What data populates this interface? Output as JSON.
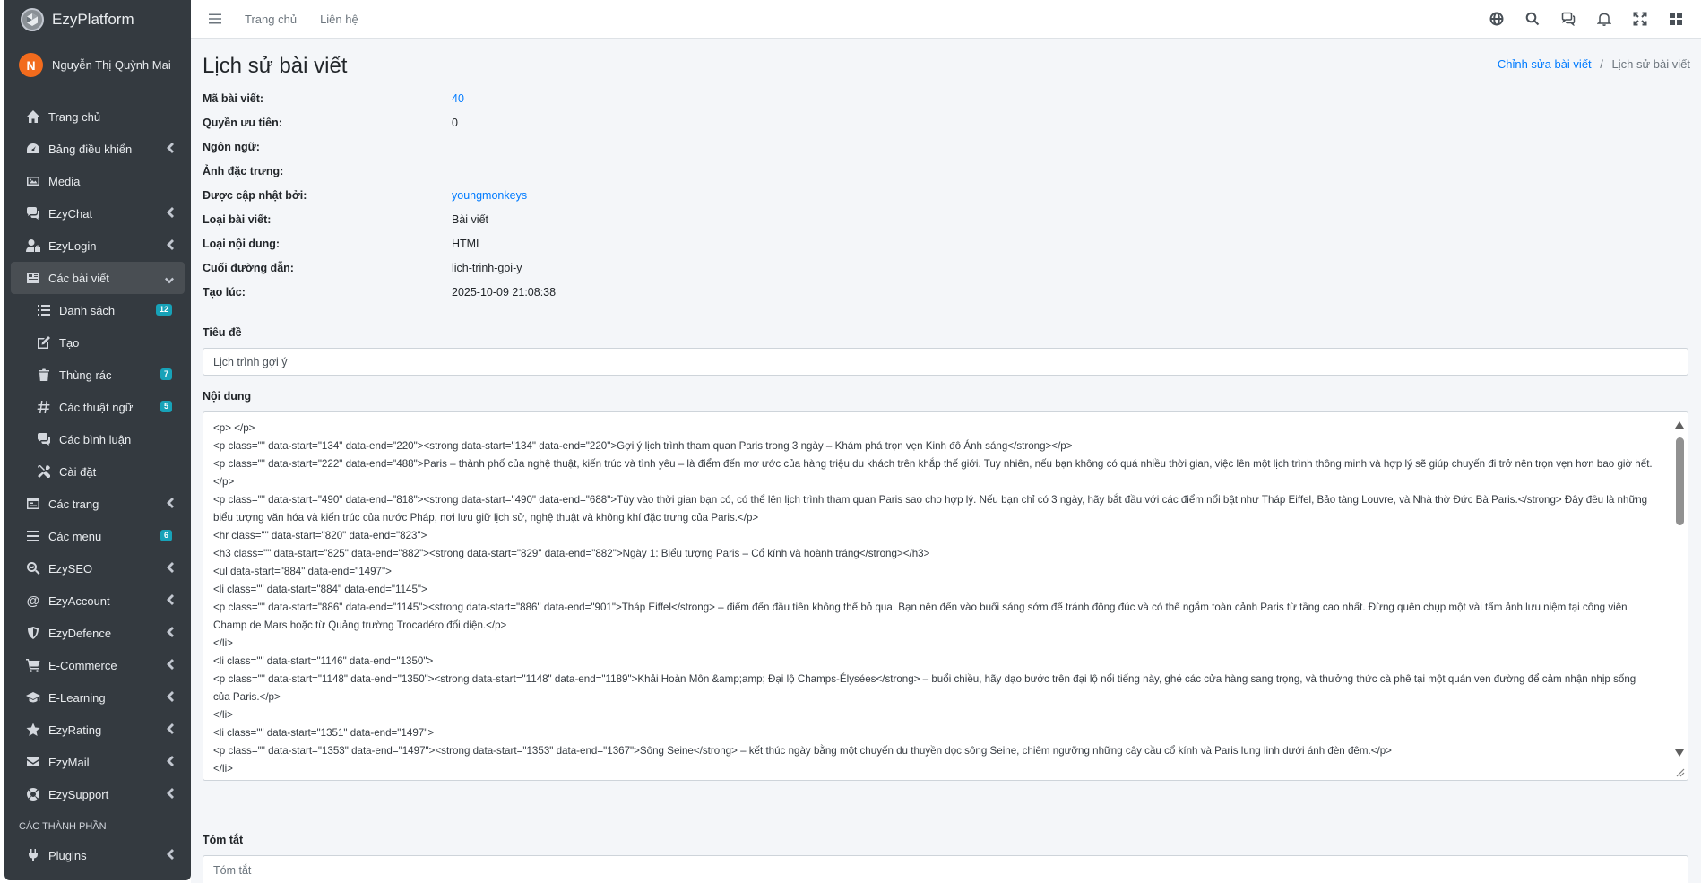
{
  "brand": {
    "name": "EzyPlatform"
  },
  "user": {
    "initial": "N",
    "name": "Nguyễn Thị Quỳnh Mai"
  },
  "sidebar": {
    "items": [
      {
        "label": "Trang chủ",
        "icon": "home-icon"
      },
      {
        "label": "Bảng điều khiển",
        "icon": "dashboard-icon"
      },
      {
        "label": "Media",
        "icon": "image-icon"
      },
      {
        "label": "EzyChat",
        "icon": "chat-icon"
      },
      {
        "label": "EzyLogin",
        "icon": "user-lock-icon"
      },
      {
        "label": "Các bài viết",
        "icon": "newspaper-icon"
      },
      {
        "label": "Danh sách",
        "icon": "list-icon",
        "badge": "12"
      },
      {
        "label": "Tạo",
        "icon": "edit-icon"
      },
      {
        "label": "Thùng rác",
        "icon": "trash-icon",
        "badge": "7"
      },
      {
        "label": "Các thuật ngữ",
        "icon": "hashtag-icon",
        "badge": "5"
      },
      {
        "label": "Các bình luận",
        "icon": "comments-icon"
      },
      {
        "label": "Cài đặt",
        "icon": "tools-icon"
      },
      {
        "label": "Các trang",
        "icon": "pages-icon"
      },
      {
        "label": "Các menu",
        "icon": "menu-icon",
        "badge": "6"
      },
      {
        "label": "EzySEO",
        "icon": "seo-icon"
      },
      {
        "label": "EzyAccount",
        "icon": "at-icon"
      },
      {
        "label": "EzyDefence",
        "icon": "shield-icon"
      },
      {
        "label": "E-Commerce",
        "icon": "cart-icon"
      },
      {
        "label": "E-Learning",
        "icon": "graduation-icon"
      },
      {
        "label": "EzyRating",
        "icon": "star-icon"
      },
      {
        "label": "EzyMail",
        "icon": "mail-icon"
      },
      {
        "label": "EzySupport",
        "icon": "support-icon"
      }
    ],
    "section_header": "CÁC THÀNH PHẦN",
    "plugins": {
      "label": "Plugins",
      "icon": "plug-icon"
    }
  },
  "topbar": {
    "home": "Trang chủ",
    "contact": "Liên hệ"
  },
  "page": {
    "title": "Lịch sử bài viết",
    "breadcrumb": {
      "parent": "Chỉnh sửa bài viết",
      "sep": "/",
      "current": "Lịch sử bài viết"
    }
  },
  "info": {
    "post_id_label": "Mã bài viết:",
    "post_id": "40",
    "priority_label": "Quyền ưu tiên:",
    "priority": "0",
    "language_label": "Ngôn ngữ:",
    "language": "",
    "featured_label": "Ảnh đặc trưng:",
    "featured": "",
    "updated_by_label": "Được cập nhật bởi:",
    "updated_by": "youngmonkeys",
    "post_type_label": "Loại bài viết:",
    "post_type": "Bài viết",
    "content_type_label": "Loại nội dung:",
    "content_type": "HTML",
    "slug_label": "Cuối đường dẫn:",
    "slug": "lich-trinh-goi-y",
    "created_label": "Tạo lúc:",
    "created": "2025-10-09 21:08:38"
  },
  "title_field": {
    "label": "Tiêu đề",
    "value": "Lịch trình gợi ý"
  },
  "content_field": {
    "label": "Nội dung",
    "lines": [
      "<p> </p>",
      "<p class=\"\" data-start=\"134\" data-end=\"220\"><strong data-start=\"134\" data-end=\"220\">Gợi ý lịch trình tham quan Paris trong 3 ngày – Khám phá trọn vẹn Kinh đô Ánh sáng</strong></p>",
      "<p class=\"\" data-start=\"222\" data-end=\"488\">Paris – thành phố của nghệ thuật, kiến trúc và tình yêu – là điểm đến mơ ước của hàng triệu du khách trên khắp thế giới. Tuy nhiên, nếu bạn không có quá nhiều thời gian, việc lên một lịch trình thông minh và hợp lý sẽ giúp chuyến đi trở nên trọn vẹn hơn bao giờ hết.</p>",
      "<p class=\"\" data-start=\"490\" data-end=\"818\"><strong data-start=\"490\" data-end=\"688\">Tùy vào thời gian bạn có, có thể lên lịch trình tham quan Paris sao cho hợp lý. Nếu bạn chỉ có 3 ngày, hãy bắt đầu với các điểm nổi bật như Tháp Eiffel, Bảo tàng Louvre, và Nhà thờ Đức Bà Paris.</strong> Đây đều là những biểu tượng văn hóa và kiến trúc của nước Pháp, nơi lưu giữ lịch sử, nghệ thuật và không khí đặc trưng của Paris.</p>",
      "<hr class=\"\" data-start=\"820\" data-end=\"823\">",
      "<h3 class=\"\" data-start=\"825\" data-end=\"882\"><strong data-start=\"829\" data-end=\"882\">Ngày 1: Biểu tượng Paris – Cổ kính và hoành tráng</strong></h3>",
      "<ul data-start=\"884\" data-end=\"1497\">",
      "<li class=\"\" data-start=\"884\" data-end=\"1145\">",
      "<p class=\"\" data-start=\"886\" data-end=\"1145\"><strong data-start=\"886\" data-end=\"901\">Tháp Eiffel</strong> – điểm đến đầu tiên không thể bỏ qua. Bạn nên đến vào buổi sáng sớm để tránh đông đúc và có thể ngắm toàn cảnh Paris từ tầng cao nhất. Đừng quên chụp một vài tấm ảnh lưu niệm tại công viên Champ de Mars hoặc từ Quảng trường Trocadéro đối diện.</p>",
      "</li>",
      "<li class=\"\" data-start=\"1146\" data-end=\"1350\">",
      "<p class=\"\" data-start=\"1148\" data-end=\"1350\"><strong data-start=\"1148\" data-end=\"1189\">Khải Hoàn Môn &amp;amp; Đại lộ Champs-Élysées</strong> – buổi chiều, hãy dạo bước trên đại lộ nổi tiếng này, ghé các cửa hàng sang trọng, và thưởng thức cà phê tại một quán ven đường để cảm nhận nhịp sống của Paris.</p>",
      "</li>",
      "<li class=\"\" data-start=\"1351\" data-end=\"1497\">",
      "<p class=\"\" data-start=\"1353\" data-end=\"1497\"><strong data-start=\"1353\" data-end=\"1367\">Sông Seine</strong> – kết thúc ngày bằng một chuyến du thuyền dọc sông Seine, chiêm ngưỡng những cây cầu cổ kính và Paris lung linh dưới ánh đèn đêm.</p>",
      "</li>"
    ]
  },
  "summary_field": {
    "label": "Tóm tắt",
    "placeholder": "Tóm tắt"
  },
  "colors": {
    "sidebar_bg": "#343a40",
    "link": "#007bff",
    "badge": "#17a2b8",
    "avatar": "#f26b1d"
  }
}
